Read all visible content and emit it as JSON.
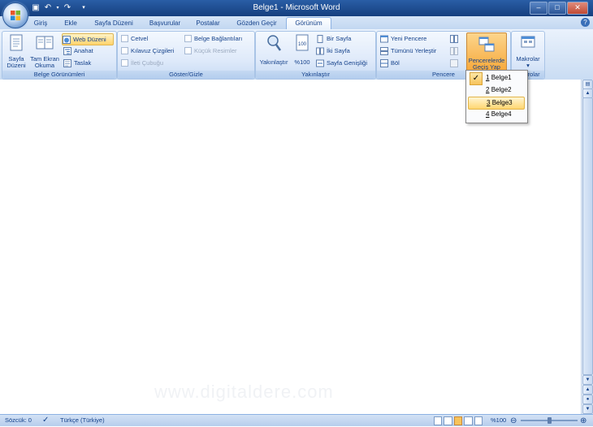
{
  "window": {
    "title": "Belge1 - Microsoft Word"
  },
  "tabs": [
    {
      "label": "Giriş"
    },
    {
      "label": "Ekle"
    },
    {
      "label": "Sayfa Düzeni"
    },
    {
      "label": "Başvurular"
    },
    {
      "label": "Postalar"
    },
    {
      "label": "Gözden Geçir"
    },
    {
      "label": "Görünüm"
    }
  ],
  "groups": {
    "belge": {
      "label": "Belge Görünümleri",
      "sayfa_duzeni": [
        "Sayfa",
        "Düzeni"
      ],
      "tam_ekran": [
        "Tam Ekran",
        "Okuma"
      ],
      "web_duzeni": "Web Düzeni",
      "anahat": "Anahat",
      "taslak": "Taslak"
    },
    "goster": {
      "label": "Göster/Gizle",
      "cetvel": "Cetvel",
      "kilavuz": "Kılavuz Çizgileri",
      "ileti": "İleti Çubuğu",
      "belge_baglantilari": "Belge Bağlantıları",
      "kucuk_resimler": "Küçük Resimler"
    },
    "yakinlastir": {
      "label": "Yakınlaştır",
      "yakinlastir": "Yakınlaştır",
      "yuzde100": "%100",
      "bir_sayfa": "Bir Sayfa",
      "iki_sayfa": "İki Sayfa",
      "sayfa_genisligi": "Sayfa Genişliği"
    },
    "pencere": {
      "label": "Pencere",
      "yeni_pencere": "Yeni Pencere",
      "tumunu_yerlestir": "Tümünü Yerleştir",
      "bol": "Böl",
      "gecis": [
        "Pencerelerde",
        "Geçiş Yap"
      ]
    },
    "makrolar": {
      "label": "Makrolar",
      "makrolar": "Makrolar"
    }
  },
  "dropdown": {
    "items": [
      {
        "num": "1",
        "name": "Belge1",
        "checked": true
      },
      {
        "num": "2",
        "name": "Belge2",
        "checked": false
      },
      {
        "num": "3",
        "name": "Belge3",
        "checked": false
      },
      {
        "num": "4",
        "name": "Belge4",
        "checked": false
      }
    ]
  },
  "document": {
    "watermark": "www.digitaldere.com"
  },
  "status": {
    "words": "Sözcük: 0",
    "language": "Türkçe (Türkiye)",
    "zoom": "%100"
  },
  "colors": {
    "accent": "#15428b",
    "ribbon": "#dfeafa",
    "highlight": "#ffd36b"
  }
}
